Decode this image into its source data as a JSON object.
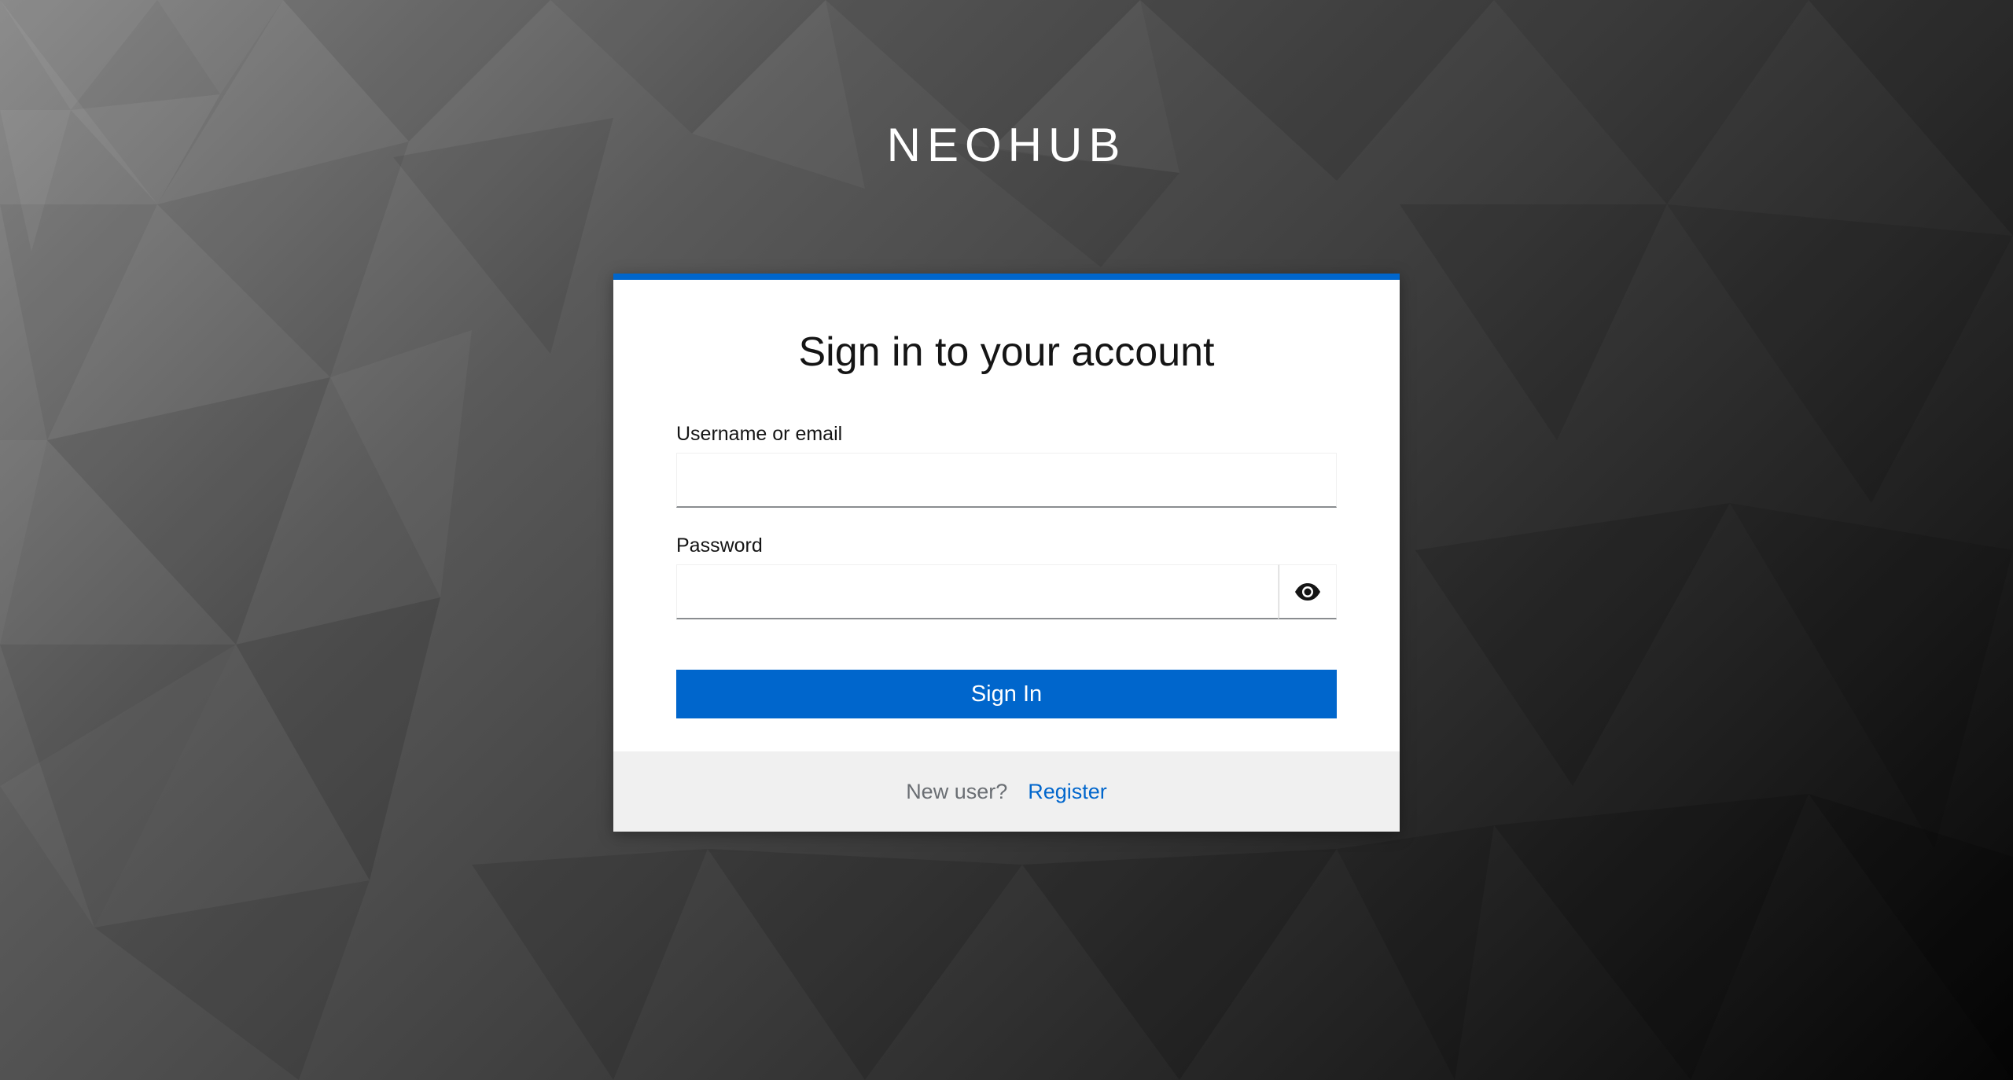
{
  "brand": {
    "name": "NEOHUB"
  },
  "login": {
    "title": "Sign in to your account",
    "username_label": "Username or email",
    "username_value": "",
    "password_label": "Password",
    "password_value": "",
    "show_password_icon": "eye-icon",
    "submit_label": "Sign In"
  },
  "footer": {
    "new_user_text": "New user?",
    "register_label": "Register"
  },
  "colors": {
    "accent": "#0066cc",
    "card_background": "#ffffff",
    "footer_background": "#f0f0f0"
  }
}
